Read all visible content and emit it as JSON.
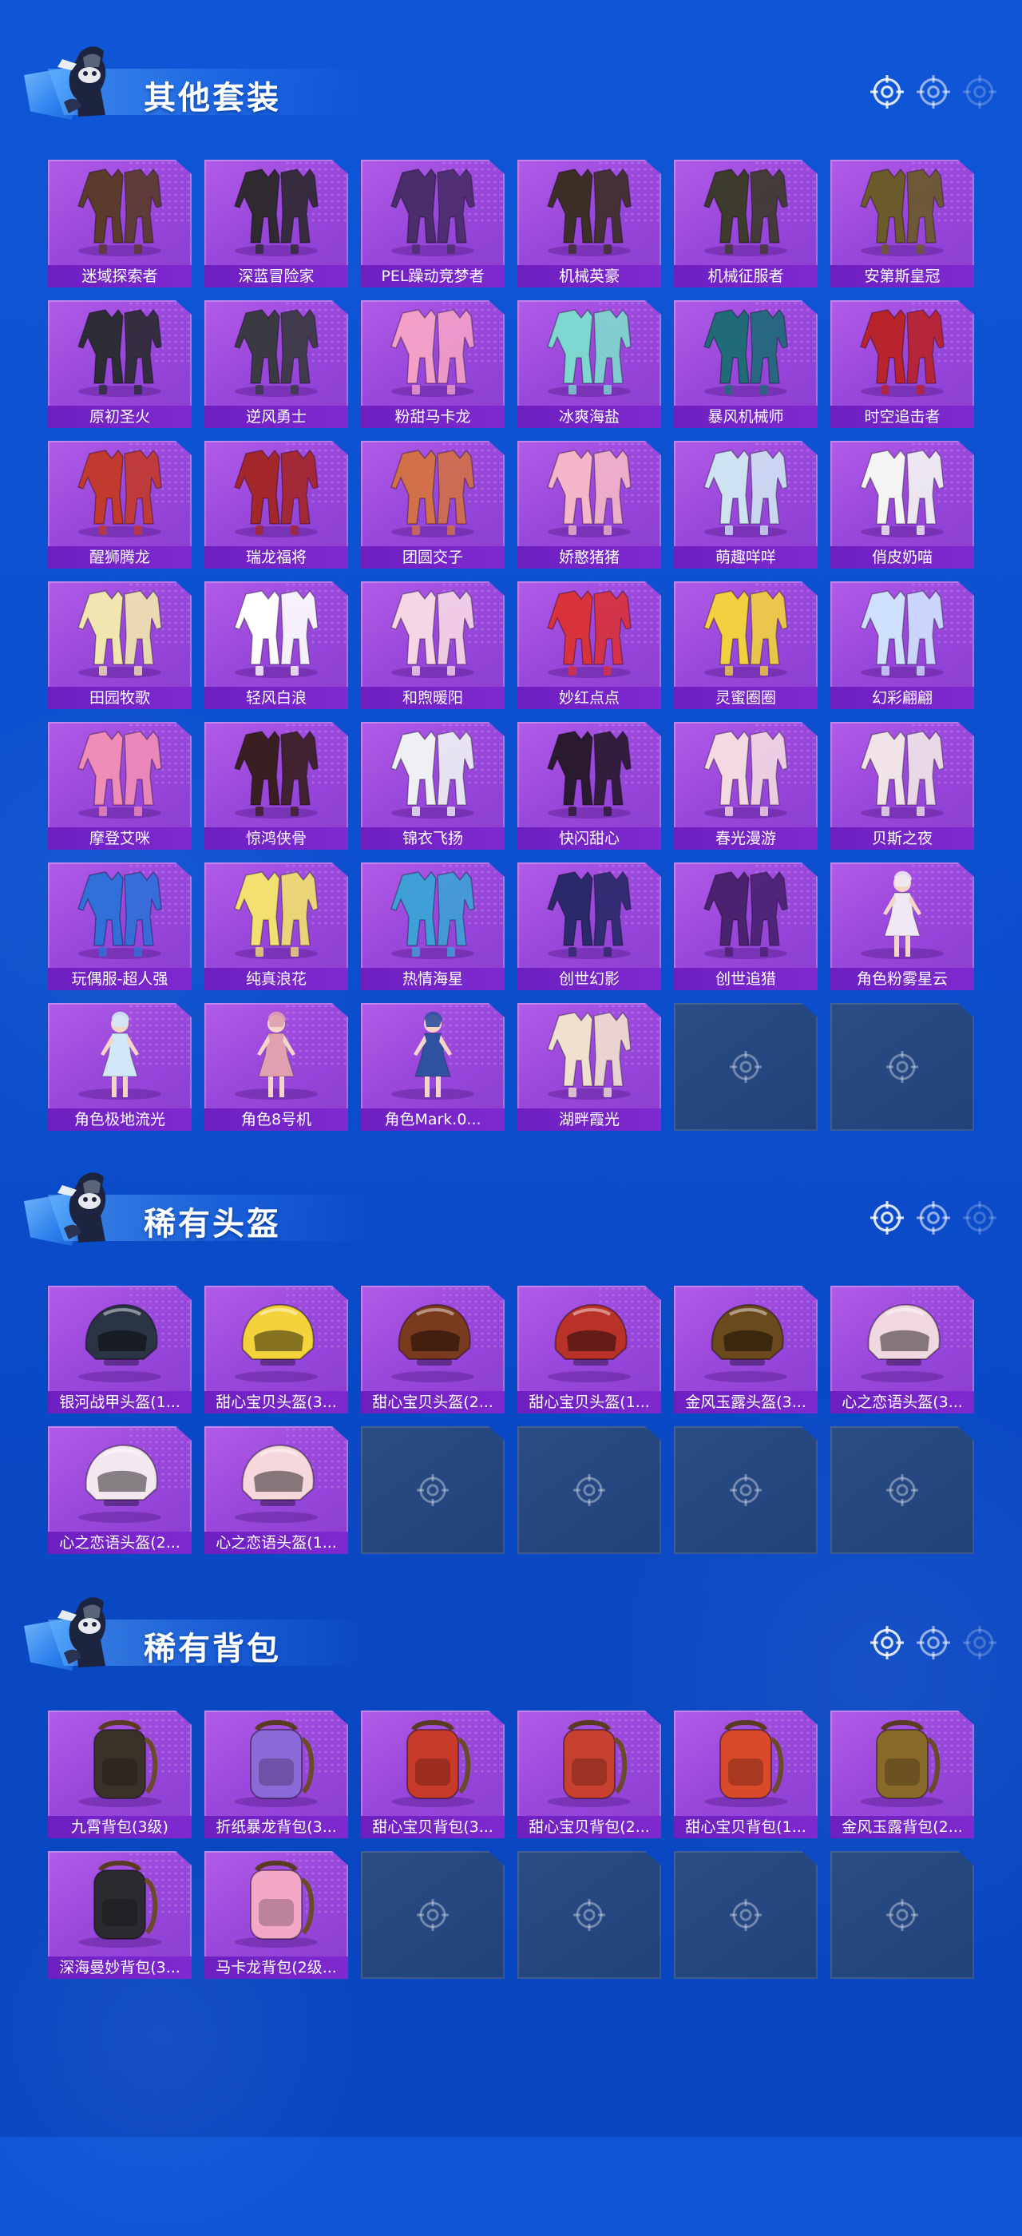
{
  "sections": [
    {
      "title": "其他套装",
      "items": [
        "迷域探索者",
        "深蓝冒险家",
        "PEL躁动竞梦者",
        "机械英豪",
        "机械征服者",
        "安第斯皇冠",
        "原初圣火",
        "逆风勇士",
        "粉甜马卡龙",
        "冰爽海盐",
        "暴风机械师",
        "时空追击者",
        "醒狮腾龙",
        "瑞龙福将",
        "团圆交子",
        "娇憨猪猪",
        "萌趣咩咩",
        "俏皮奶喵",
        "田园牧歌",
        "轻风白浪",
        "和煦暖阳",
        "妙红点点",
        "灵蜜圈圈",
        "幻彩翩翩",
        "摩登艾咪",
        "惊鸿侠骨",
        "锦衣飞扬",
        "快闪甜心",
        "春光漫游",
        "贝斯之夜",
        "玩偶服-超人强",
        "纯真浪花",
        "热情海星",
        "创世幻影",
        "创世追猎",
        "角色粉雾星云",
        "角色极地流光",
        "角色8号机",
        "角色Mark.0...",
        "湖畔霞光"
      ],
      "item_types": [
        "suit",
        "suit",
        "suit",
        "suit",
        "suit",
        "suit",
        "suit",
        "suit",
        "suit",
        "suit",
        "suit",
        "suit",
        "suit",
        "suit",
        "suit",
        "suit",
        "suit",
        "suit",
        "suit",
        "suit",
        "suit",
        "suit",
        "suit",
        "suit",
        "suit",
        "suit",
        "suit",
        "suit",
        "suit",
        "suit",
        "suit",
        "suit",
        "suit",
        "suit",
        "suit",
        "figure",
        "figure",
        "figure",
        "figure",
        "suit"
      ],
      "item_colors": [
        "#5a3b2c",
        "#2e2a30",
        "#4a2d6b",
        "#3d2f28",
        "#3e3a2c",
        "#6b5a2a",
        "#2c2c34",
        "#3a3a42",
        "#f2a0c8",
        "#7fd8d0",
        "#1f6b78",
        "#b8232c",
        "#c23a2e",
        "#a3262a",
        "#d2704a",
        "#f4b6c8",
        "#cfe2f2",
        "#f4f4f4",
        "#f1e6b0",
        "#ffffff",
        "#f6d6e6",
        "#d8323c",
        "#f2d040",
        "#cfe0ff",
        "#f08cb8",
        "#3a1f22",
        "#eef0f4",
        "#2a1a30",
        "#f4d8e2",
        "#f0e4e8",
        "#3070d8",
        "#f2e070",
        "#3fa0d8",
        "#2a2a6a",
        "#4a2270",
        "#f0e8f4",
        "#d0e8f8",
        "#e0a0b0",
        "#3050a0",
        "#f0e0d0"
      ],
      "empty_slots": 2
    },
    {
      "title": "稀有头盔",
      "items": [
        "银河战甲头盔(1...",
        "甜心宝贝头盔(3...",
        "甜心宝贝头盔(2...",
        "甜心宝贝头盔(1...",
        "金风玉露头盔(3...",
        "心之恋语头盔(3...",
        "心之恋语头盔(2...",
        "心之恋语头盔(1..."
      ],
      "item_types": [
        "helmet",
        "helmet",
        "helmet",
        "helmet",
        "helmet",
        "helmet",
        "helmet",
        "helmet"
      ],
      "item_colors": [
        "#2a3444",
        "#f4d23c",
        "#7a3a1e",
        "#b83228",
        "#6a4a1c",
        "#f0d8e0",
        "#f4e8f0",
        "#f6d8dc"
      ],
      "empty_slots": 4
    },
    {
      "title": "稀有背包",
      "items": [
        "九霄背包(3级)",
        "折纸暴龙背包(3...",
        "甜心宝贝背包(3...",
        "甜心宝贝背包(2...",
        "甜心宝贝背包(1...",
        "金风玉露背包(2...",
        "深海曼妙背包(3...",
        "马卡龙背包(2级..."
      ],
      "item_types": [
        "backpack",
        "backpack",
        "backpack",
        "backpack",
        "backpack",
        "backpack",
        "backpack",
        "backpack"
      ],
      "item_colors": [
        "#3a3228",
        "#8c6ad8",
        "#c83a2a",
        "#c84030",
        "#d84a2a",
        "#8a6a2a",
        "#2a2a30",
        "#f4a8c8"
      ],
      "empty_slots": 4
    }
  ],
  "icons": {
    "header_mascot": "mascot-icon",
    "header_decor": "crosshair-icon",
    "empty_slot": "crosshair-icon"
  },
  "colors": {
    "background": "#0c4fcf",
    "card": "#a352e0",
    "card_label": "#7426c6",
    "empty_slot": "#244577"
  }
}
